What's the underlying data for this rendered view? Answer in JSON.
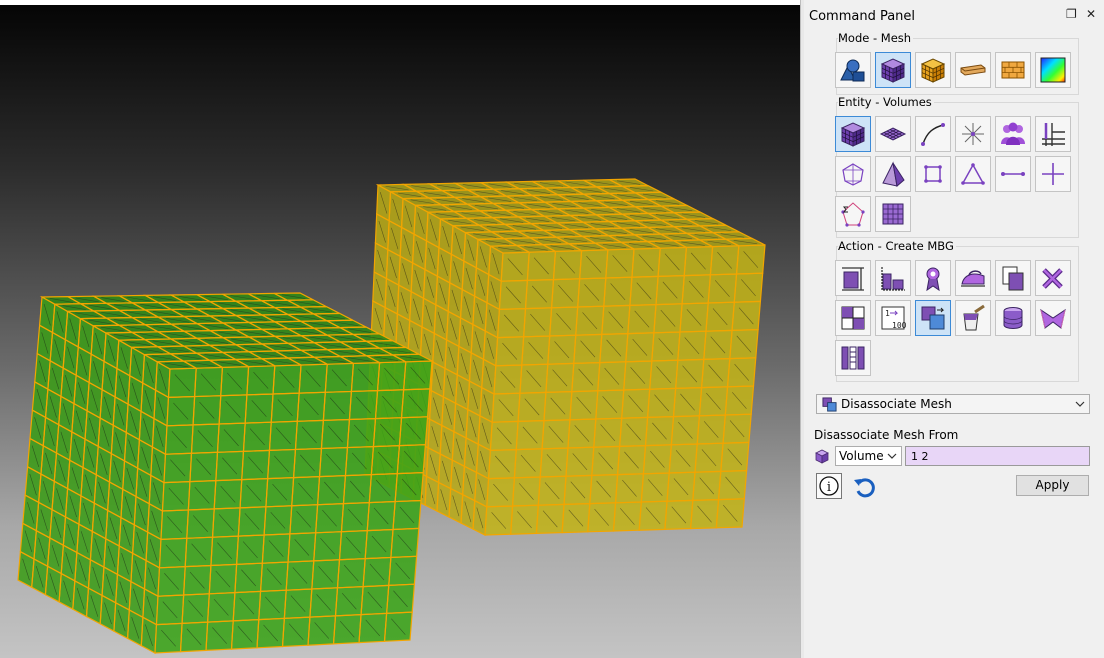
{
  "panel": {
    "title": "Command Panel",
    "float_glyph": "❐",
    "close_glyph": "✕"
  },
  "mode": {
    "label": "Mode - Mesh",
    "buttons": [
      {
        "name": "geometry-mode",
        "icon": "geometry-shapes-icon"
      },
      {
        "name": "mesh-mode",
        "icon": "mesh-cube-icon",
        "selected": true
      },
      {
        "name": "boundary-conditions-mode",
        "icon": "orange-mesh-cube-icon"
      },
      {
        "name": "materials-mode",
        "icon": "material-beam-icon"
      },
      {
        "name": "blocks-mode",
        "icon": "blocks-icon"
      },
      {
        "name": "analysis-mode",
        "icon": "contour-gradient-icon"
      }
    ]
  },
  "entity": {
    "label": "Entity - Volumes",
    "buttons": [
      {
        "name": "entity-volumes",
        "icon": "volume-mesh-icon",
        "selected": true
      },
      {
        "name": "entity-surfaces",
        "icon": "surface-mesh-icon"
      },
      {
        "name": "entity-curves",
        "icon": "curve-icon"
      },
      {
        "name": "entity-nodes",
        "icon": "node-star-icon"
      },
      {
        "name": "entity-groups",
        "icon": "group-people-icon"
      },
      {
        "name": "entity-grid",
        "icon": "grid-icon"
      },
      {
        "name": "entity-hex",
        "icon": "hex-element-icon"
      },
      {
        "name": "entity-tet",
        "icon": "tet-element-icon"
      },
      {
        "name": "entity-quad",
        "icon": "quad-element-icon"
      },
      {
        "name": "entity-tri",
        "icon": "tri-element-icon"
      },
      {
        "name": "entity-edge",
        "icon": "edge-element-icon"
      },
      {
        "name": "entity-node-element",
        "icon": "cross-node-icon"
      },
      {
        "name": "entity-sum",
        "icon": "sigma-icon"
      },
      {
        "name": "entity-matrix",
        "icon": "purple-grid-icon"
      }
    ]
  },
  "action": {
    "label": "Action - Create MBG",
    "buttons": [
      {
        "name": "action-1",
        "icon": "hex-build-icon"
      },
      {
        "name": "action-2",
        "icon": "mesh-columns-icon"
      },
      {
        "name": "action-3",
        "icon": "ribbon-icon"
      },
      {
        "name": "action-4",
        "icon": "iron-icon"
      },
      {
        "name": "action-5",
        "icon": "copy-icon"
      },
      {
        "name": "action-6",
        "icon": "delete-x-icon"
      },
      {
        "name": "action-7",
        "icon": "split-grid-icon"
      },
      {
        "name": "action-8",
        "icon": "renumber-icon"
      },
      {
        "name": "action-9",
        "icon": "disassociate-icon",
        "selected": true
      },
      {
        "name": "action-10",
        "icon": "paint-bucket-icon"
      },
      {
        "name": "action-11",
        "icon": "cylinder-icon"
      },
      {
        "name": "action-12",
        "icon": "warp-icon"
      },
      {
        "name": "action-13",
        "icon": "columns-icon"
      }
    ]
  },
  "operation": {
    "selected": "Disassociate Mesh",
    "icon": "disassociate-icon"
  },
  "form": {
    "from_label": "Disassociate Mesh From",
    "entity_type": "Volume",
    "ids_value": "1 2",
    "apply_label": "Apply",
    "info_glyph": "i",
    "icons": {
      "entity": "volume-cube-icon",
      "reset": "reset-arrow-icon"
    }
  },
  "colors": {
    "mesh_edge": "#f2a500",
    "green_face": "#3aa318",
    "yellow_face": "#c2b318",
    "selected_button": "#cde3f7",
    "id_field": "#e8d6f7"
  }
}
